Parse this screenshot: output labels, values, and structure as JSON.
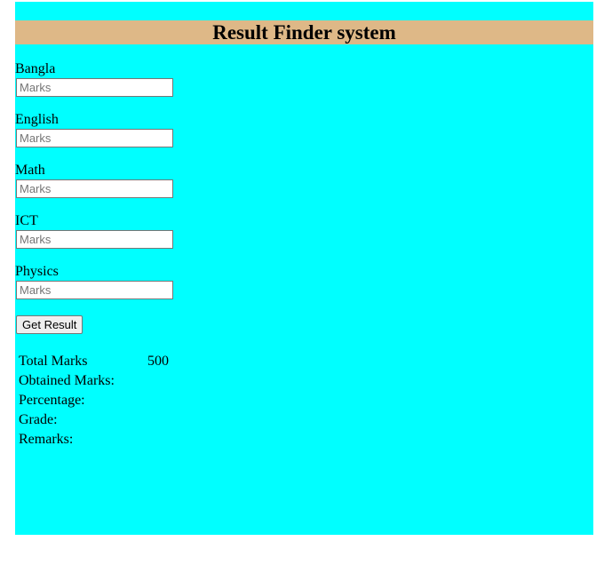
{
  "header": {
    "title": "Result Finder system"
  },
  "subjects": [
    {
      "label": "Bangla",
      "placeholder": "Marks",
      "value": ""
    },
    {
      "label": "English",
      "placeholder": "Marks",
      "value": ""
    },
    {
      "label": "Math",
      "placeholder": "Marks",
      "value": ""
    },
    {
      "label": "ICT",
      "placeholder": "Marks",
      "value": ""
    },
    {
      "label": "Physics",
      "placeholder": "Marks",
      "value": ""
    }
  ],
  "actions": {
    "get_result_label": "Get Result"
  },
  "results": [
    {
      "label": "Total Marks",
      "value": "500"
    },
    {
      "label": "Obtained Marks:",
      "value": ""
    },
    {
      "label": "Percentage:",
      "value": ""
    },
    {
      "label": "Grade:",
      "value": ""
    },
    {
      "label": "Remarks:",
      "value": ""
    }
  ],
  "colors": {
    "panel_background": "#00ffff",
    "header_background": "#deb887"
  }
}
